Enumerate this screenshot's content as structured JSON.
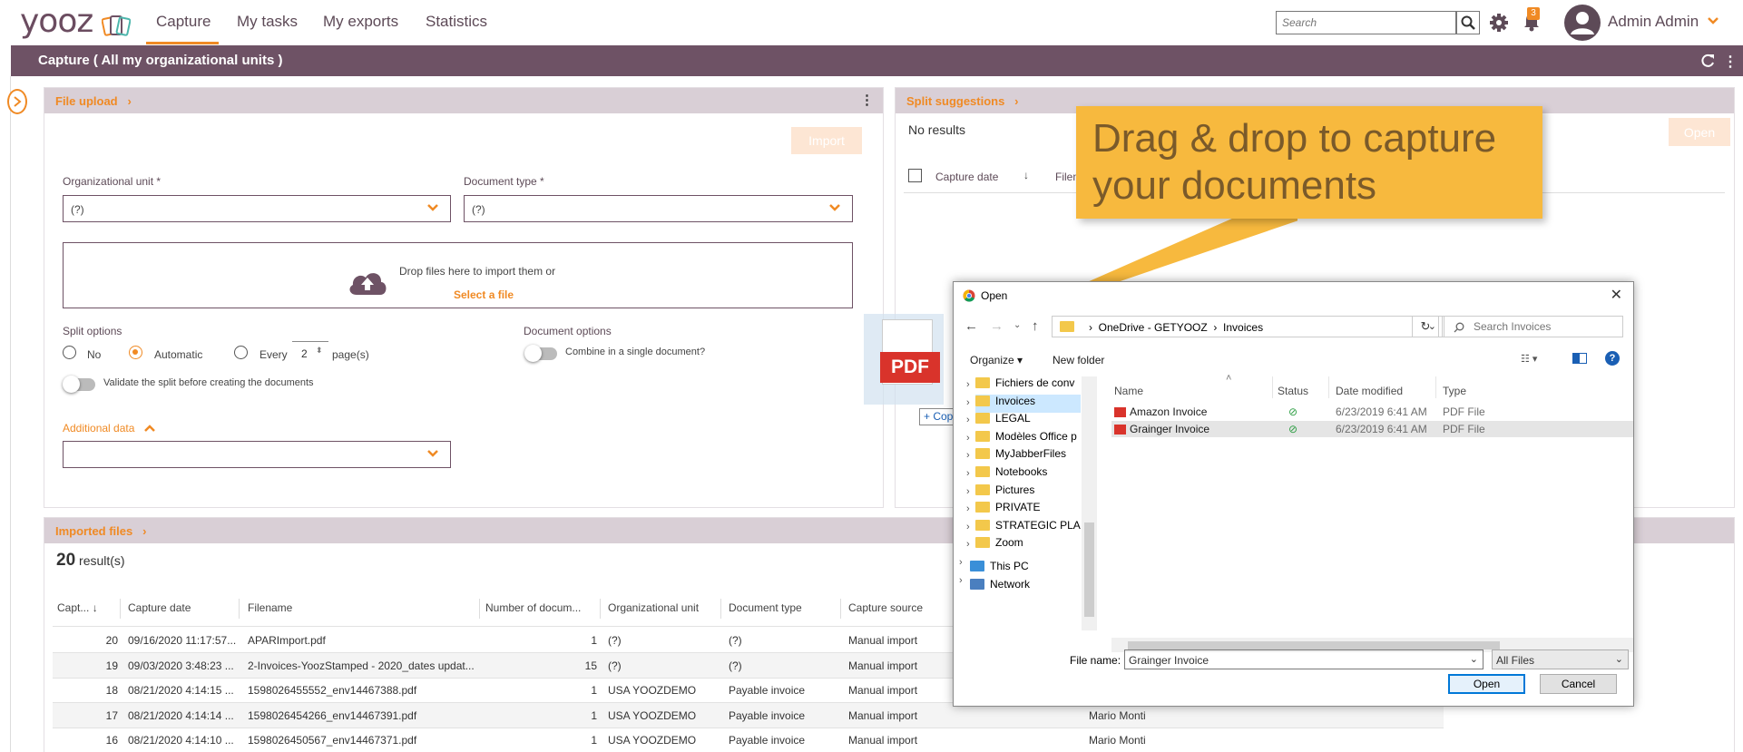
{
  "app": {
    "logo": "yooz"
  },
  "nav": {
    "tabs": [
      {
        "label": "Capture"
      },
      {
        "label": "My tasks"
      },
      {
        "label": "My exports"
      },
      {
        "label": "Statistics"
      }
    ]
  },
  "search": {
    "placeholder": "Search"
  },
  "notifications": {
    "count": "3"
  },
  "user": {
    "name": "Admin Admin"
  },
  "page": {
    "title": "Capture ( All my organizational units )"
  },
  "file_upload": {
    "title": "File upload",
    "import_label": "Import",
    "org_unit_label": "Organizational unit *",
    "org_unit_value": "(?)",
    "doc_type_label": "Document type *",
    "doc_type_value": "(?)",
    "drop_text": "Drop files here to import them or",
    "select_link": "Select a file",
    "split_options_label": "Split options",
    "split_no": "No",
    "split_automatic": "Automatic",
    "split_every": "Every",
    "split_every_value": "2",
    "split_pages": "page(s)",
    "validate_split": "Validate the split before creating the documents",
    "doc_options_label": "Document options",
    "combine_label": "Combine in a single document?",
    "additional_data": "Additional data"
  },
  "split_suggestions": {
    "title": "Split suggestions",
    "no_results": "No results",
    "open_label": "Open",
    "col_capture_date": "Capture date",
    "col_filename": "Filen"
  },
  "imported_files": {
    "title": "Imported files",
    "count": "20",
    "results_suffix": "result(s)",
    "columns": [
      "Capt...",
      "Capture date",
      "Filename",
      "Number of docum...",
      "Organizational unit",
      "Document type",
      "Capture source"
    ],
    "rows": [
      {
        "n": "20",
        "date": "09/16/2020 11:17:57...",
        "file": "APARImport.pdf",
        "docs": "1",
        "org": "(?)",
        "type": "(?)",
        "source": "Manual import",
        "user": ""
      },
      {
        "n": "19",
        "date": "09/03/2020 3:48:23 ...",
        "file": "2-Invoices-YoozStamped - 2020_dates updat...",
        "docs": "15",
        "org": "(?)",
        "type": "(?)",
        "source": "Manual import",
        "user": ""
      },
      {
        "n": "18",
        "date": "08/21/2020 4:14:15 ...",
        "file": "1598026455552_env14467388.pdf",
        "docs": "1",
        "org": "USA YOOZDEMO",
        "type": "Payable invoice",
        "source": "Manual import",
        "user": ""
      },
      {
        "n": "17",
        "date": "08/21/2020 4:14:14 ...",
        "file": "1598026454266_env14467391.pdf",
        "docs": "1",
        "org": "USA YOOZDEMO",
        "type": "Payable invoice",
        "source": "Manual import",
        "user": "Mario Monti"
      },
      {
        "n": "16",
        "date": "08/21/2020 4:14:10 ...",
        "file": "1598026450567_env14467371.pdf",
        "docs": "1",
        "org": "USA YOOZDEMO",
        "type": "Payable invoice",
        "source": "Manual import",
        "user": "Mario Monti"
      }
    ]
  },
  "callout": {
    "text": "Drag & drop to capture your documents"
  },
  "drag": {
    "pdf_label": "PDF",
    "copy_label": "+ Copy"
  },
  "dialog": {
    "title": "Open",
    "path": [
      "OneDrive - GETYOOZ",
      "Invoices"
    ],
    "search_placeholder": "Search Invoices",
    "organize": "Organize ▾",
    "new_folder": "New folder",
    "nav_items": [
      "Fichiers de conv",
      "Invoices",
      "LEGAL",
      "Modèles Office p",
      "MyJabberFiles",
      "Notebooks",
      "Pictures",
      "PRIVATE",
      "STRATEGIC PLAN",
      "Zoom",
      "This PC",
      "Network"
    ],
    "columns": [
      "Name",
      "Status",
      "Date modified",
      "Type"
    ],
    "files": [
      {
        "name": "Amazon Invoice",
        "date": "6/23/2019 6:41 AM",
        "type": "PDF File"
      },
      {
        "name": "Grainger Invoice",
        "date": "6/23/2019 6:41 AM",
        "type": "PDF File"
      }
    ],
    "file_name_label": "File name:",
    "file_name_value": "Grainger Invoice",
    "file_type_value": "All Files",
    "open_label": "Open",
    "cancel_label": "Cancel"
  },
  "colors": {
    "accent": "#f08a24",
    "brand": "#6e5265",
    "panel_header": "#d9cfd6",
    "callout": "#f7b93e"
  }
}
